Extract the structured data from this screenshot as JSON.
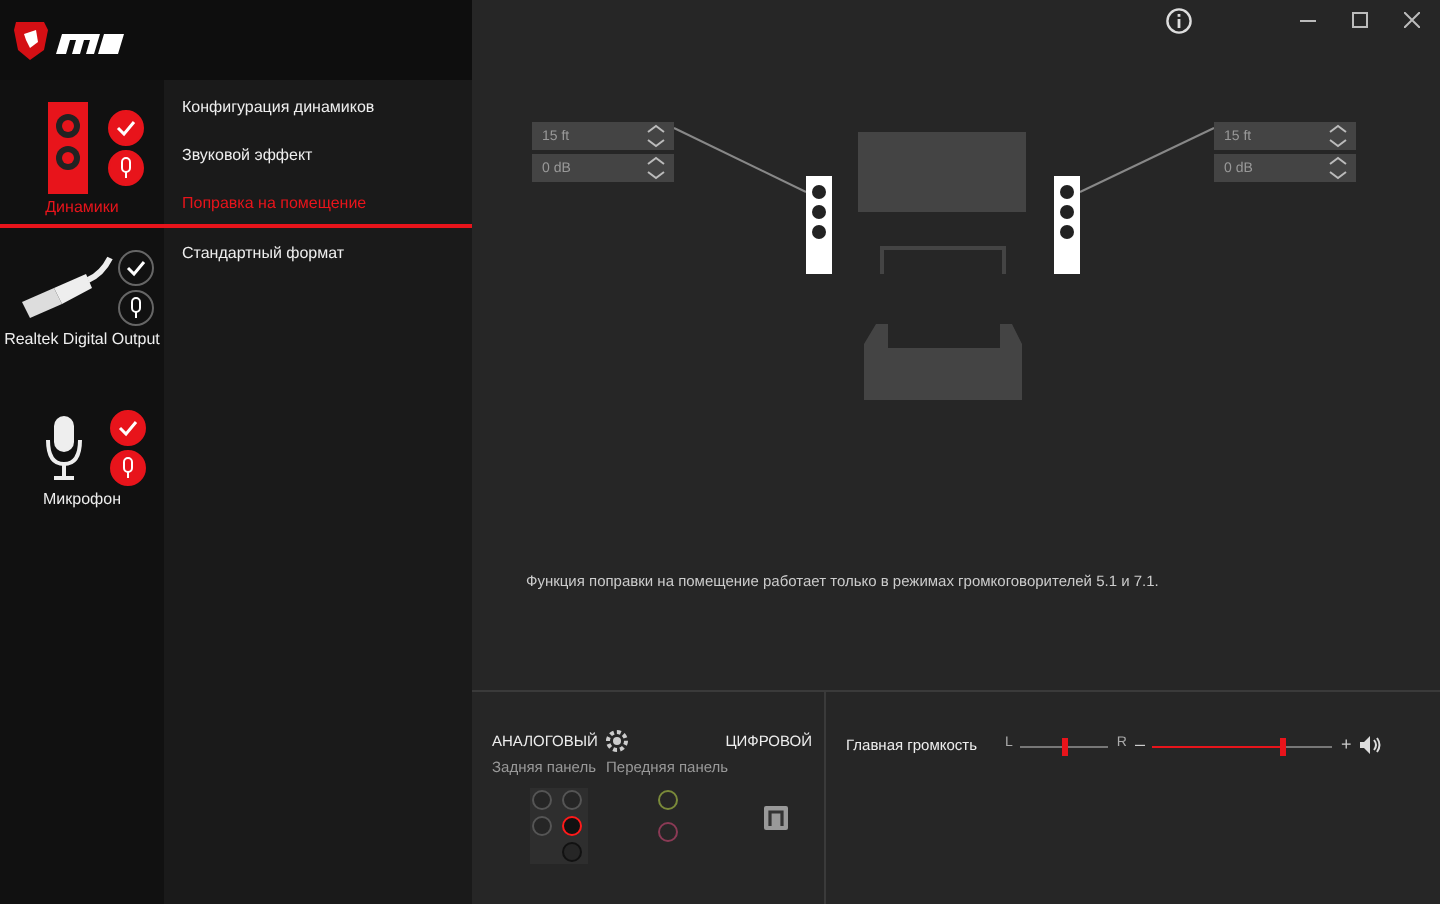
{
  "devices": [
    {
      "name": "Динамики",
      "kind": "speaker",
      "selected": true,
      "default_device": true,
      "default_communication": true
    },
    {
      "name": "Realtek Digital Output",
      "kind": "cable",
      "selected": false,
      "default_device": false,
      "default_communication": false
    },
    {
      "name": "Микрофон",
      "kind": "microphone",
      "selected": false,
      "default_device": true,
      "default_communication": true
    }
  ],
  "menu": [
    {
      "label": "Конфигурация динамиков",
      "selected": false
    },
    {
      "label": "Звуковой эффект",
      "selected": false
    },
    {
      "label": "Поправка на помещение",
      "selected": true
    },
    {
      "label": "Стандартный формат",
      "selected": false
    }
  ],
  "room": {
    "left": {
      "distance": "15 ft",
      "gain": "0 dB"
    },
    "right": {
      "distance": "15 ft",
      "gain": "0 dB"
    },
    "note": "Функция поправки на помещение работает только в режимах громкоговорителей 5.1 и 7.1."
  },
  "connectors": {
    "analog_label": "АНАЛОГОВЫЙ",
    "digital_label": "ЦИФРОВОЙ",
    "rear_label": "Задняя панель",
    "front_label": "Передняя панель",
    "rear_jacks": [
      {
        "color": "#555555",
        "selected": false
      },
      {
        "color": "#555555",
        "selected": false
      },
      {
        "color": "#555555",
        "selected": false
      },
      {
        "color": "#ff1a1a",
        "selected": true
      },
      {
        "color": "#111111",
        "selected": false
      }
    ],
    "front_jacks": [
      {
        "color": "#7a8a3a",
        "selected": false
      },
      {
        "color": "#8a3a55",
        "selected": false
      }
    ]
  },
  "volume": {
    "label": "Главная громкость",
    "left": "L",
    "right": "R",
    "balance": {
      "level": 0.5
    },
    "minus": "–",
    "plus": "+",
    "master": {
      "level": 0.72
    }
  }
}
